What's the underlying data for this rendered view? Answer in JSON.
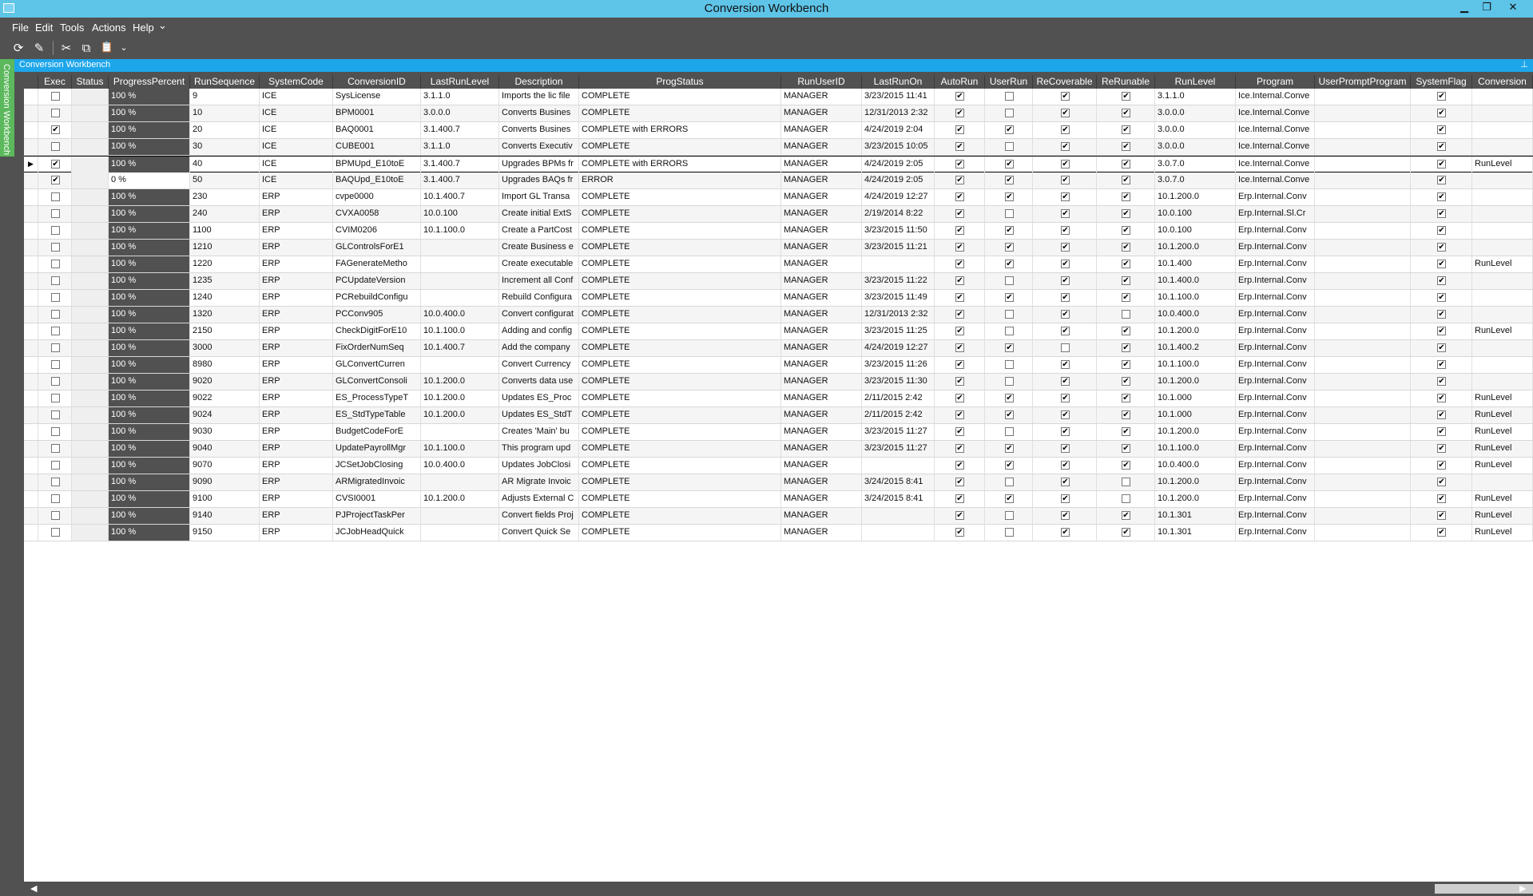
{
  "window": {
    "title": "Conversion Workbench",
    "buttons": {
      "minimize": "▁",
      "restore": "❐",
      "close": "✕"
    }
  },
  "menu": {
    "items": [
      "File",
      "Edit",
      "Tools",
      "Actions",
      "Help"
    ],
    "more": "⌄"
  },
  "toolbar": {
    "refresh_icon": "⟳",
    "clear_icon": "✎",
    "cut_icon": "✂",
    "copy_icon": "⧉",
    "paste_icon": "📋",
    "more": "⌄"
  },
  "panel": {
    "title": "Conversion Workbench",
    "pin_icon": "⊥",
    "side_tab": "Conversion Workbench"
  },
  "grid": {
    "columns": [
      "Exec",
      "Status",
      "ProgressPercent",
      "RunSequence",
      "SystemCode",
      "ConversionID",
      "LastRunLevel",
      "Description",
      "ProgStatus",
      "RunUserID",
      "LastRunOn",
      "AutoRun",
      "UserRun",
      "ReCoverable",
      "ReRunable",
      "RunLevel",
      "Program",
      "UserPromptProgram",
      "SystemFlag",
      "Conversion"
    ],
    "rows": [
      {
        "exec": false,
        "progress": "100 %",
        "seq": "9",
        "sys": "ICE",
        "conv": "SysLicense",
        "lastlevel": "3.1.1.0",
        "desc": "Imports the lic file",
        "progstatus": "COMPLETE",
        "user": "MANAGER",
        "lastrun": "3/23/2015 11:41",
        "autorun": true,
        "userrun": false,
        "recov": true,
        "rerun": true,
        "runlevel": "3.1.1.0",
        "program": "Ice.Internal.Conve",
        "prompt": "",
        "sysflag": true,
        "convlast": ""
      },
      {
        "exec": false,
        "progress": "100 %",
        "seq": "10",
        "sys": "ICE",
        "conv": "BPM0001",
        "lastlevel": "3.0.0.0",
        "desc": "Converts Busines",
        "progstatus": "COMPLETE",
        "user": "MANAGER",
        "lastrun": "12/31/2013 2:32",
        "autorun": true,
        "userrun": false,
        "recov": true,
        "rerun": true,
        "runlevel": "3.0.0.0",
        "program": "Ice.Internal.Conve",
        "prompt": "",
        "sysflag": true,
        "convlast": ""
      },
      {
        "exec": true,
        "progress": "100 %",
        "seq": "20",
        "sys": "ICE",
        "conv": "BAQ0001",
        "lastlevel": "3.1.400.7",
        "desc": "Converts Busines",
        "progstatus": "COMPLETE with ERRORS",
        "user": "MANAGER",
        "lastrun": "4/24/2019 2:04",
        "autorun": true,
        "userrun": true,
        "recov": true,
        "rerun": true,
        "runlevel": "3.0.0.0",
        "program": "Ice.Internal.Conve",
        "prompt": "",
        "sysflag": true,
        "convlast": ""
      },
      {
        "exec": false,
        "progress": "100 %",
        "seq": "30",
        "sys": "ICE",
        "conv": "CUBE001",
        "lastlevel": "3.1.1.0",
        "desc": "Converts Executiv",
        "progstatus": "COMPLETE",
        "user": "MANAGER",
        "lastrun": "3/23/2015 10:05",
        "autorun": true,
        "userrun": false,
        "recov": true,
        "rerun": true,
        "runlevel": "3.0.0.0",
        "program": "Ice.Internal.Conve",
        "prompt": "",
        "sysflag": true,
        "convlast": ""
      },
      {
        "exec": true,
        "progress": "100 %",
        "seq": "40",
        "sys": "ICE",
        "conv": "BPMUpd_E10toE",
        "lastlevel": "3.1.400.7",
        "desc": "Upgrades BPMs fr",
        "progstatus": "COMPLETE with ERRORS",
        "user": "MANAGER",
        "lastrun": "4/24/2019 2:05",
        "autorun": true,
        "userrun": true,
        "recov": true,
        "rerun": true,
        "runlevel": "3.0.7.0",
        "program": "Ice.Internal.Conve",
        "prompt": "",
        "sysflag": true,
        "convlast": "RunLevel"
      },
      {
        "exec": true,
        "progress": "0 %",
        "seq": "50",
        "sys": "ICE",
        "conv": "BAQUpd_E10toE",
        "lastlevel": "3.1.400.7",
        "desc": "Upgrades BAQs fr",
        "progstatus": "ERROR",
        "user": "MANAGER",
        "lastrun": "4/24/2019 2:05",
        "autorun": true,
        "userrun": true,
        "recov": true,
        "rerun": true,
        "runlevel": "3.0.7.0",
        "program": "Ice.Internal.Conve",
        "prompt": "",
        "sysflag": true,
        "convlast": ""
      },
      {
        "exec": false,
        "progress": "100 %",
        "seq": "230",
        "sys": "ERP",
        "conv": "cvpe0000",
        "lastlevel": "10.1.400.7",
        "desc": "Import GL Transa",
        "progstatus": "COMPLETE",
        "user": "MANAGER",
        "lastrun": "4/24/2019 12:27",
        "autorun": true,
        "userrun": true,
        "recov": true,
        "rerun": true,
        "runlevel": "10.1.200.0",
        "program": "Erp.Internal.Conv",
        "prompt": "",
        "sysflag": true,
        "convlast": ""
      },
      {
        "exec": false,
        "progress": "100 %",
        "seq": "240",
        "sys": "ERP",
        "conv": "CVXA0058",
        "lastlevel": "10.0.100",
        "desc": "Create initial ExtS",
        "progstatus": "COMPLETE",
        "user": "MANAGER",
        "lastrun": "2/19/2014 8:22",
        "autorun": true,
        "userrun": false,
        "recov": true,
        "rerun": true,
        "runlevel": "10.0.100",
        "program": "Erp.Internal.Sl.Cr",
        "prompt": "",
        "sysflag": true,
        "convlast": ""
      },
      {
        "exec": false,
        "progress": "100 %",
        "seq": "1100",
        "sys": "ERP",
        "conv": "CVIM0206",
        "lastlevel": "10.1.100.0",
        "desc": "Create a PartCost",
        "progstatus": "COMPLETE",
        "user": "MANAGER",
        "lastrun": "3/23/2015 11:50",
        "autorun": true,
        "userrun": true,
        "recov": true,
        "rerun": true,
        "runlevel": "10.0.100",
        "program": "Erp.Internal.Conv",
        "prompt": "",
        "sysflag": true,
        "convlast": ""
      },
      {
        "exec": false,
        "progress": "100 %",
        "seq": "1210",
        "sys": "ERP",
        "conv": "GLControlsForE1",
        "lastlevel": "",
        "desc": "Create Business e",
        "progstatus": "COMPLETE",
        "user": "MANAGER",
        "lastrun": "3/23/2015 11:21",
        "autorun": true,
        "userrun": true,
        "recov": true,
        "rerun": true,
        "runlevel": "10.1.200.0",
        "program": "Erp.Internal.Conv",
        "prompt": "",
        "sysflag": true,
        "convlast": ""
      },
      {
        "exec": false,
        "progress": "100 %",
        "seq": "1220",
        "sys": "ERP",
        "conv": "FAGenerateMetho",
        "lastlevel": "",
        "desc": "Create executable",
        "progstatus": "COMPLETE",
        "user": "MANAGER",
        "lastrun": "",
        "autorun": true,
        "userrun": true,
        "recov": true,
        "rerun": true,
        "runlevel": "10.1.400",
        "program": "Erp.Internal.Conv",
        "prompt": "",
        "sysflag": true,
        "convlast": "RunLevel"
      },
      {
        "exec": false,
        "progress": "100 %",
        "seq": "1235",
        "sys": "ERP",
        "conv": "PCUpdateVersion",
        "lastlevel": "",
        "desc": "Increment all Conf",
        "progstatus": "COMPLETE",
        "user": "MANAGER",
        "lastrun": "3/23/2015 11:22",
        "autorun": true,
        "userrun": false,
        "recov": true,
        "rerun": true,
        "runlevel": "10.1.400.0",
        "program": "Erp.Internal.Conv",
        "prompt": "",
        "sysflag": true,
        "convlast": ""
      },
      {
        "exec": false,
        "progress": "100 %",
        "seq": "1240",
        "sys": "ERP",
        "conv": "PCRebuildConfigu",
        "lastlevel": "",
        "desc": "Rebuild Configura",
        "progstatus": "COMPLETE",
        "user": "MANAGER",
        "lastrun": "3/23/2015 11:49",
        "autorun": true,
        "userrun": true,
        "recov": true,
        "rerun": true,
        "runlevel": "10.1.100.0",
        "program": "Erp.Internal.Conv",
        "prompt": "",
        "sysflag": true,
        "convlast": ""
      },
      {
        "exec": false,
        "progress": "100 %",
        "seq": "1320",
        "sys": "ERP",
        "conv": "PCConv905",
        "lastlevel": "10.0.400.0",
        "desc": "Convert configurat",
        "progstatus": "COMPLETE",
        "user": "MANAGER",
        "lastrun": "12/31/2013 2:32",
        "autorun": true,
        "userrun": false,
        "recov": true,
        "rerun": false,
        "runlevel": "10.0.400.0",
        "program": "Erp.Internal.Conv",
        "prompt": "",
        "sysflag": true,
        "convlast": ""
      },
      {
        "exec": false,
        "progress": "100 %",
        "seq": "2150",
        "sys": "ERP",
        "conv": "CheckDigitForE10",
        "lastlevel": "10.1.100.0",
        "desc": "Adding and config",
        "progstatus": "COMPLETE",
        "user": "MANAGER",
        "lastrun": "3/23/2015 11:25",
        "autorun": true,
        "userrun": false,
        "recov": true,
        "rerun": true,
        "runlevel": "10.1.200.0",
        "program": "Erp.Internal.Conv",
        "prompt": "",
        "sysflag": true,
        "convlast": "RunLevel"
      },
      {
        "exec": false,
        "progress": "100 %",
        "seq": "3000",
        "sys": "ERP",
        "conv": "FixOrderNumSeq",
        "lastlevel": "10.1.400.7",
        "desc": "Add the company",
        "progstatus": "COMPLETE",
        "user": "MANAGER",
        "lastrun": "4/24/2019 12:27",
        "autorun": true,
        "userrun": true,
        "recov": false,
        "rerun": true,
        "runlevel": "10.1.400.2",
        "program": "Erp.Internal.Conv",
        "prompt": "",
        "sysflag": true,
        "convlast": ""
      },
      {
        "exec": false,
        "progress": "100 %",
        "seq": "8980",
        "sys": "ERP",
        "conv": "GLConvertCurren",
        "lastlevel": "",
        "desc": "Convert Currency",
        "progstatus": "COMPLETE",
        "user": "MANAGER",
        "lastrun": "3/23/2015 11:26",
        "autorun": true,
        "userrun": false,
        "recov": true,
        "rerun": true,
        "runlevel": "10.1.100.0",
        "program": "Erp.Internal.Conv",
        "prompt": "",
        "sysflag": true,
        "convlast": ""
      },
      {
        "exec": false,
        "progress": "100 %",
        "seq": "9020",
        "sys": "ERP",
        "conv": "GLConvertConsoli",
        "lastlevel": "10.1.200.0",
        "desc": "Converts data use",
        "progstatus": "COMPLETE",
        "user": "MANAGER",
        "lastrun": "3/23/2015 11:30",
        "autorun": true,
        "userrun": false,
        "recov": true,
        "rerun": true,
        "runlevel": "10.1.200.0",
        "program": "Erp.Internal.Conv",
        "prompt": "",
        "sysflag": true,
        "convlast": ""
      },
      {
        "exec": false,
        "progress": "100 %",
        "seq": "9022",
        "sys": "ERP",
        "conv": "ES_ProcessTypeT",
        "lastlevel": "10.1.200.0",
        "desc": "Updates ES_Proc",
        "progstatus": "COMPLETE",
        "user": "MANAGER",
        "lastrun": "2/11/2015 2:42",
        "autorun": true,
        "userrun": true,
        "recov": true,
        "rerun": true,
        "runlevel": "10.1.000",
        "program": "Erp.Internal.Conv",
        "prompt": "",
        "sysflag": true,
        "convlast": "RunLevel"
      },
      {
        "exec": false,
        "progress": "100 %",
        "seq": "9024",
        "sys": "ERP",
        "conv": "ES_StdTypeTable",
        "lastlevel": "10.1.200.0",
        "desc": "Updates ES_StdT",
        "progstatus": "COMPLETE",
        "user": "MANAGER",
        "lastrun": "2/11/2015 2:42",
        "autorun": true,
        "userrun": true,
        "recov": true,
        "rerun": true,
        "runlevel": "10.1.000",
        "program": "Erp.Internal.Conv",
        "prompt": "",
        "sysflag": true,
        "convlast": "RunLevel"
      },
      {
        "exec": false,
        "progress": "100 %",
        "seq": "9030",
        "sys": "ERP",
        "conv": "BudgetCodeForE",
        "lastlevel": "",
        "desc": "Creates 'Main' bu",
        "progstatus": "COMPLETE",
        "user": "MANAGER",
        "lastrun": "3/23/2015 11:27",
        "autorun": true,
        "userrun": false,
        "recov": true,
        "rerun": true,
        "runlevel": "10.1.200.0",
        "program": "Erp.Internal.Conv",
        "prompt": "",
        "sysflag": true,
        "convlast": "RunLevel"
      },
      {
        "exec": false,
        "progress": "100 %",
        "seq": "9040",
        "sys": "ERP",
        "conv": "UpdatePayrollMgr",
        "lastlevel": "10.1.100.0",
        "desc": "This program upd",
        "progstatus": "COMPLETE",
        "user": "MANAGER",
        "lastrun": "3/23/2015 11:27",
        "autorun": true,
        "userrun": true,
        "recov": true,
        "rerun": true,
        "runlevel": "10.1.100.0",
        "program": "Erp.Internal.Conv",
        "prompt": "",
        "sysflag": true,
        "convlast": "RunLevel"
      },
      {
        "exec": false,
        "progress": "100 %",
        "seq": "9070",
        "sys": "ERP",
        "conv": "JCSetJobClosing",
        "lastlevel": "10.0.400.0",
        "desc": "Updates JobClosi",
        "progstatus": "COMPLETE",
        "user": "MANAGER",
        "lastrun": "",
        "autorun": true,
        "userrun": true,
        "recov": true,
        "rerun": true,
        "runlevel": "10.0.400.0",
        "program": "Erp.Internal.Conv",
        "prompt": "",
        "sysflag": true,
        "convlast": "RunLevel"
      },
      {
        "exec": false,
        "progress": "100 %",
        "seq": "9090",
        "sys": "ERP",
        "conv": "ARMigratedInvoic",
        "lastlevel": "",
        "desc": "AR Migrate Invoic",
        "progstatus": "COMPLETE",
        "user": "MANAGER",
        "lastrun": "3/24/2015 8:41",
        "autorun": true,
        "userrun": false,
        "recov": true,
        "rerun": false,
        "runlevel": "10.1.200.0",
        "program": "Erp.Internal.Conv",
        "prompt": "",
        "sysflag": true,
        "convlast": ""
      },
      {
        "exec": false,
        "progress": "100 %",
        "seq": "9100",
        "sys": "ERP",
        "conv": "CVSI0001",
        "lastlevel": "10.1.200.0",
        "desc": "Adjusts External C",
        "progstatus": "COMPLETE",
        "user": "MANAGER",
        "lastrun": "3/24/2015 8:41",
        "autorun": true,
        "userrun": true,
        "recov": true,
        "rerun": false,
        "runlevel": "10.1.200.0",
        "program": "Erp.Internal.Conv",
        "prompt": "",
        "sysflag": true,
        "convlast": "RunLevel"
      },
      {
        "exec": false,
        "progress": "100 %",
        "seq": "9140",
        "sys": "ERP",
        "conv": "PJProjectTaskPer",
        "lastlevel": "",
        "desc": "Convert fields Proj",
        "progstatus": "COMPLETE",
        "user": "MANAGER",
        "lastrun": "",
        "autorun": true,
        "userrun": false,
        "recov": true,
        "rerun": true,
        "runlevel": "10.1.301",
        "program": "Erp.Internal.Conv",
        "prompt": "",
        "sysflag": true,
        "convlast": "RunLevel"
      },
      {
        "exec": false,
        "progress": "100 %",
        "seq": "9150",
        "sys": "ERP",
        "conv": "JCJobHeadQuick",
        "lastlevel": "",
        "desc": "Convert Quick Se",
        "progstatus": "COMPLETE",
        "user": "MANAGER",
        "lastrun": "",
        "autorun": true,
        "userrun": false,
        "recov": true,
        "rerun": true,
        "runlevel": "10.1.301",
        "program": "Erp.Internal.Conv",
        "prompt": "",
        "sysflag": true,
        "convlast": "RunLevel"
      }
    ],
    "active_row": 4,
    "active_marker": "▶"
  },
  "scrollbar": {
    "left_arrow": "◀",
    "right_arrow": "▶"
  }
}
